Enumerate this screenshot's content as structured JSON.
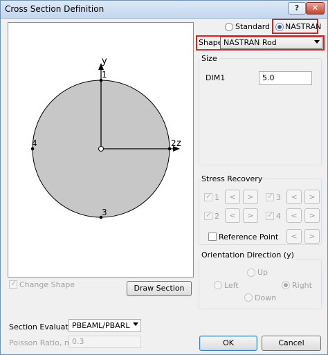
{
  "window": {
    "title": "Cross Section Definition",
    "help_label": "?",
    "close_label": "✕"
  },
  "mode": {
    "standard_label": "Standard",
    "nastran_label": "NASTRAN",
    "selected": "NASTRAN"
  },
  "shape": {
    "label": "Shape",
    "value": "NASTRAN Rod"
  },
  "size": {
    "title": "Size",
    "dim1_label": "DIM1",
    "dim1_value": "5.0"
  },
  "diagram": {
    "axis_y": "y",
    "axis_z": "z",
    "point_labels": [
      "1",
      "2",
      "3",
      "4"
    ],
    "colors": {
      "fill": "#c7c7c7",
      "outline": "#000000"
    }
  },
  "stress_recovery": {
    "title": "Stress Recovery",
    "points": [
      {
        "label": "1",
        "checked": true
      },
      {
        "label": "2",
        "checked": true
      },
      {
        "label": "3",
        "checked": true
      },
      {
        "label": "4",
        "checked": true
      }
    ],
    "left_label": "<",
    "right_label": ">",
    "reference_point_label": "Reference Point",
    "reference_point_checked": false
  },
  "orientation": {
    "title": "Orientation Direction (y)",
    "up_label": "Up",
    "left_label": "Left",
    "right_label": "Right",
    "down_label": "Down",
    "selected": "Right"
  },
  "change_shape": {
    "label": "Change Shape",
    "checked": true
  },
  "draw_section_label": "Draw Section",
  "section_evaluation": {
    "label": "Section Evaluation",
    "value": "PBEAML/PBARL"
  },
  "poisson": {
    "label": "Poisson Ratio, nu",
    "value": "0.3"
  },
  "footer": {
    "ok_label": "OK",
    "cancel_label": "Cancel"
  }
}
